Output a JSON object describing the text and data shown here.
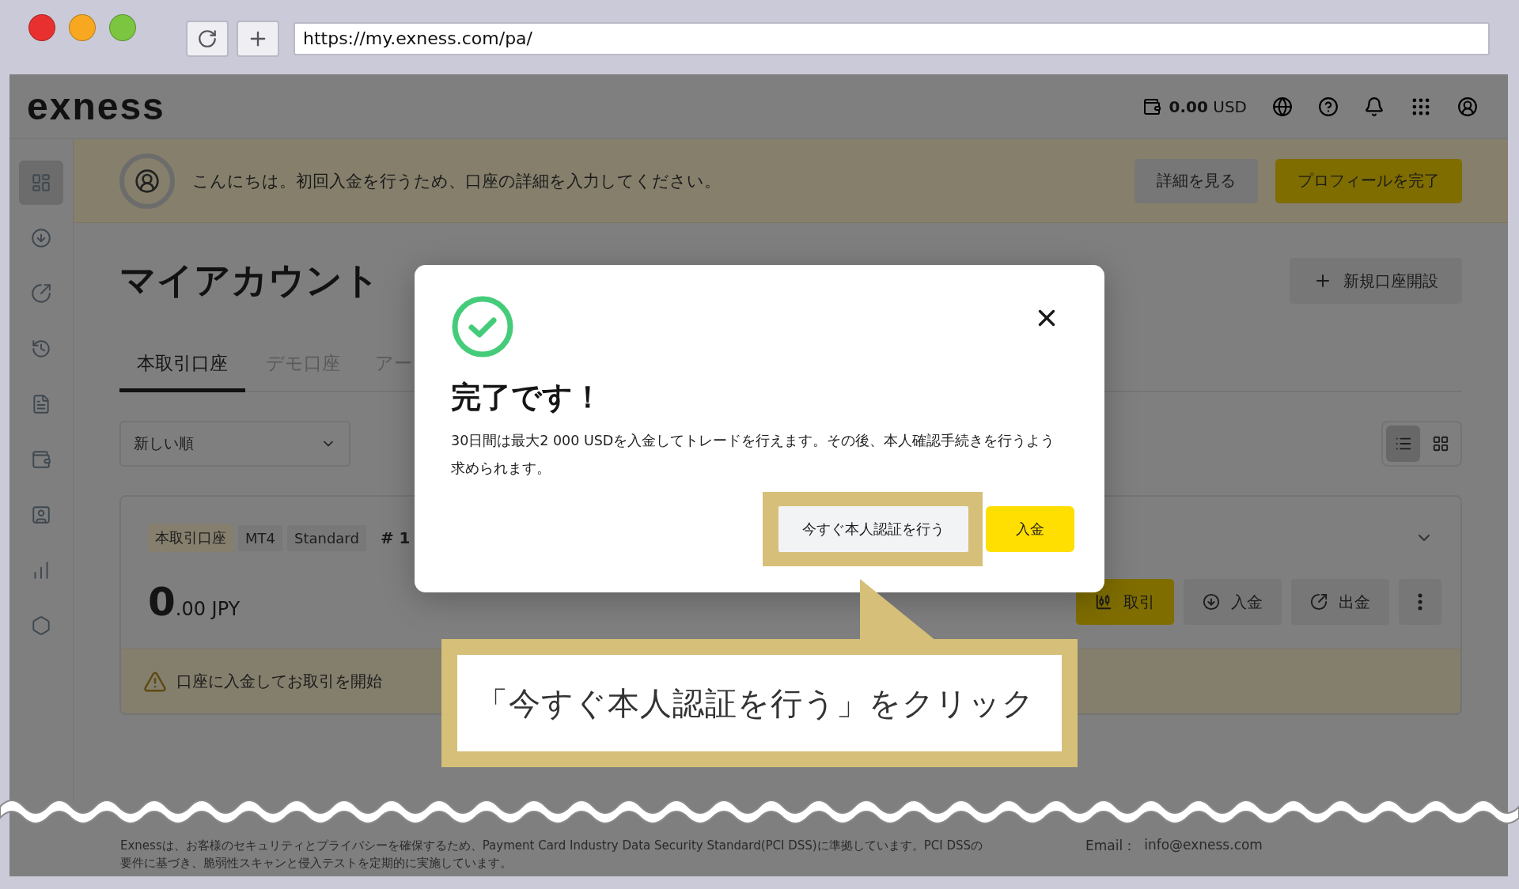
{
  "browser": {
    "url": "https://my.exness.com/pa/"
  },
  "header": {
    "logo": "exness",
    "balance_amount": "0.00",
    "balance_currency": "USD"
  },
  "sidebar": {
    "items": [
      {
        "selected": true
      },
      {
        "selected": false
      },
      {
        "selected": false
      },
      {
        "selected": false
      },
      {
        "selected": false
      },
      {
        "selected": false
      },
      {
        "selected": false
      },
      {
        "selected": false
      },
      {
        "selected": false
      }
    ]
  },
  "banner": {
    "text": "こんにちは。初回入金を行うため、口座の詳細を入力してください。",
    "details_button": "詳細を見る",
    "complete_button": "プロフィールを完了"
  },
  "page": {
    "title": "マイアカウント",
    "new_account_button": "新規口座開設"
  },
  "tabs": [
    {
      "label": "本取引口座",
      "selected": true
    },
    {
      "label": "デモ口座",
      "selected": false
    },
    {
      "label": "アー",
      "selected": false
    }
  ],
  "sort": {
    "value": "新しい順"
  },
  "view_toggle": [
    {
      "selected": true
    },
    {
      "selected": false
    }
  ],
  "account": {
    "tags": [
      "本取引口座",
      "MT4",
      "Standard"
    ],
    "number": "# 1",
    "balance_whole": "0",
    "balance_rest": ".00 JPY",
    "actions": [
      {
        "label": "取引",
        "kind": "trade"
      },
      {
        "label": "入金",
        "kind": "deposit"
      },
      {
        "label": "出金",
        "kind": "withdraw"
      },
      {
        "kind": "more"
      }
    ],
    "notice": "口座に入金してお取引を開始"
  },
  "modal": {
    "title": "完了です！",
    "message": "30日間は最大2 000 USDを入金してトレードを行えます。その後、本人確認手続きを行うよう求められます。",
    "buttons": [
      {
        "label": "今すぐ本人認証を行う",
        "kind": "secondary",
        "highlighted": true
      },
      {
        "label": "入金",
        "kind": "primary",
        "highlighted": false
      }
    ]
  },
  "callout": {
    "text": "「今すぐ本人認証を行う」をクリック"
  },
  "footer": {
    "disclaimer": "Exnessは、お客様のセキュリティとプライバシーを確保するため、Payment Card Industry Data Security Standard(PCI DSS)に準拠しています。PCI DSSの要件に基づき、脆弱性スキャンと侵入テストを定期的に実施しています。",
    "email_label": "Email：",
    "email": "info@exness.com"
  }
}
